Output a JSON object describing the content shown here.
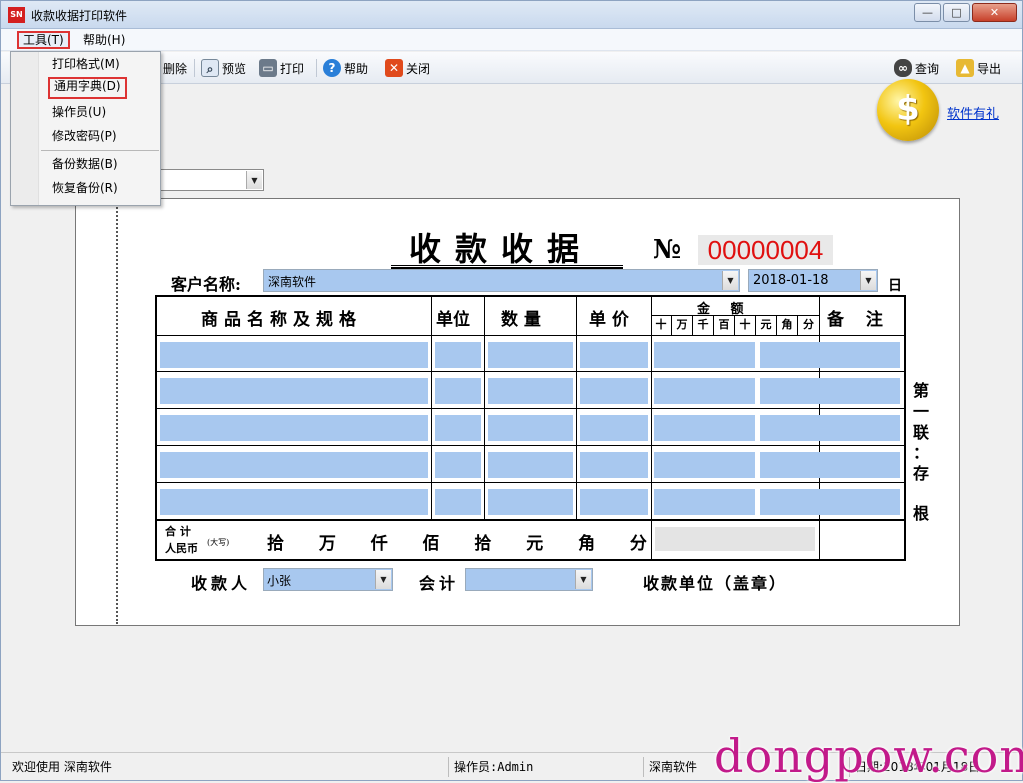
{
  "window": {
    "title": "收款收据打印软件",
    "icon_text": "SN"
  },
  "menubar": {
    "tools": "工具(T)",
    "help": "帮助(H)"
  },
  "dropdown": {
    "items": [
      "打印格式(M)",
      "通用字典(D)",
      "操作员(U)",
      "修改密码(P)",
      "备份数据(B)",
      "恢复备份(R)"
    ]
  },
  "toolbar": {
    "delete": "删除",
    "preview": "预览",
    "print": "打印",
    "help": "帮助",
    "close": "关闭",
    "query": "查询",
    "export": "导出"
  },
  "promo": {
    "coin": "$",
    "link": "软件有礼"
  },
  "receipt": {
    "title": "收款收据",
    "no_symbol": "№",
    "number": "00000004",
    "customer_label": "客户名称:",
    "customer_value": "深南软件",
    "date_value": "2018-01-18",
    "date_unit": "日",
    "headers": {
      "name": "商品名称及规格",
      "unit": "单位",
      "qty": "数 量",
      "price": "单 价",
      "amount": "金 额",
      "remark": "备 注"
    },
    "amount_digits": [
      "十",
      "万",
      "千",
      "百",
      "十",
      "元",
      "角",
      "分"
    ],
    "total_label_1": "合 计",
    "total_label_2": "人民币",
    "total_label_sup": "(大写)",
    "total_units": [
      "拾",
      "万",
      "仟",
      "佰",
      "拾",
      "元",
      "角",
      "分"
    ],
    "payee_label": "收款人",
    "payee_value": "小张",
    "accountant_label": "会计",
    "accountant_value": "",
    "unit_label": "收款单位（盖章）",
    "side_text": [
      "第",
      "一",
      "联",
      "：",
      "存",
      "根"
    ]
  },
  "statusbar": {
    "welcome": "欢迎使用  深南软件",
    "operator": "操作员:Admin",
    "company": "深南软件",
    "date": "日期:2018年01月18日"
  },
  "watermark": "dongpow.com",
  "colors": {
    "field": "#a8c8ef",
    "number": "#e01010",
    "highlight_border": "#dd3333"
  }
}
